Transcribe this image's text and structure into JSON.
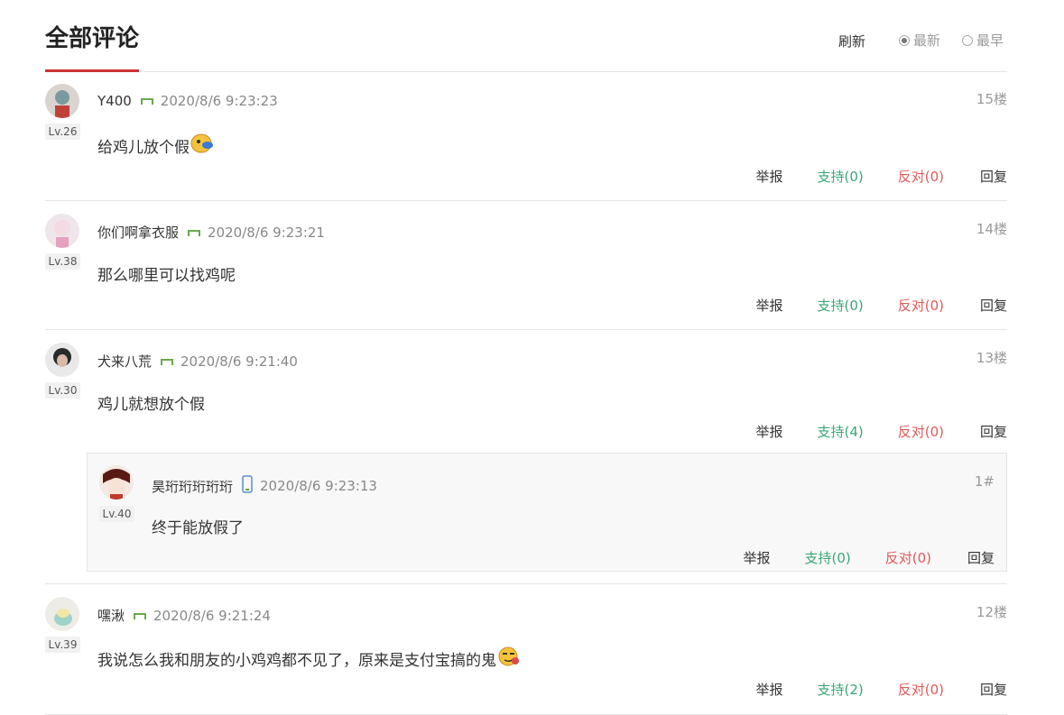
{
  "header": {
    "title": "全部评论",
    "refresh": "刷新",
    "sort_latest": "最新",
    "sort_earliest": "最早"
  },
  "comments": [
    {
      "user": "Y400",
      "level": "Lv.26",
      "time": "2020/8/6 9:23:23",
      "floor": "15楼",
      "text": "给鸡儿放个假",
      "report": "举报",
      "support": "支持(0)",
      "oppose": "反对(0)",
      "reply": "回复"
    },
    {
      "user": "你们啊拿衣服",
      "level": "Lv.38",
      "time": "2020/8/6 9:23:21",
      "floor": "14楼",
      "text": "那么哪里可以找鸡呢",
      "report": "举报",
      "support": "支持(0)",
      "oppose": "反对(0)",
      "reply": "回复"
    },
    {
      "user": "犬来八荒",
      "level": "Lv.30",
      "time": "2020/8/6 9:21:40",
      "floor": "13楼",
      "text": "鸡儿就想放个假",
      "report": "举报",
      "support": "支持(4)",
      "oppose": "反对(0)",
      "reply": "回复",
      "sub": {
        "user": "昊珩珩珩珩珩",
        "level": "Lv.40",
        "time": "2020/8/6 9:23:13",
        "floor": "1#",
        "text": "终于能放假了",
        "report": "举报",
        "support": "支持(0)",
        "oppose": "反对(0)",
        "reply": "回复"
      }
    },
    {
      "user": "嘿湫",
      "level": "Lv.39",
      "time": "2020/8/6 9:21:24",
      "floor": "12楼",
      "text": "我说怎么我和朋友的小鸡鸡都不见了，原来是支付宝搞的鬼",
      "report": "举报",
      "support": "支持(2)",
      "oppose": "反对(0)",
      "reply": "回复"
    }
  ]
}
